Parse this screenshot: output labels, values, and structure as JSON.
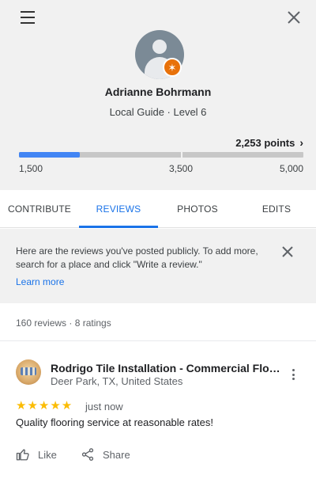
{
  "header": {
    "menu_icon": "hamburger-menu-icon",
    "close_icon": "close-icon"
  },
  "profile": {
    "name": "Adrianne Bohrmann",
    "level_text": "Local Guide · Level 6",
    "badge_icon": "local-guide-star-icon",
    "badge_color": "#e8710a"
  },
  "progress": {
    "points_label": "2,253 points",
    "chevron": "›",
    "min_label": "1,500",
    "mid_label": "3,500",
    "max_label": "5,000",
    "min": 1500,
    "max": 5000,
    "value": 2253,
    "fill_color": "#4285f4"
  },
  "tabs": [
    {
      "label": "CONTRIBUTE",
      "active": false
    },
    {
      "label": "REVIEWS",
      "active": true
    },
    {
      "label": "PHOTOS",
      "active": false
    },
    {
      "label": "EDITS",
      "active": false
    }
  ],
  "info_banner": {
    "text": "Here are the reviews you've posted publicly. To add more, search for a place and click \"Write a review.\"",
    "link": "Learn more"
  },
  "counts": "160 reviews · 8 ratings",
  "review_card": {
    "business_name": "Rodrigo Tile Installation - Commercial Floor...",
    "address": "Deer Park, TX, United States",
    "rating": 5,
    "stars": "★★★★★",
    "time": "just now",
    "text": "Quality flooring service at reasonable rates!",
    "like_label": "Like",
    "share_label": "Share",
    "star_color": "#fbbc04"
  },
  "accent_color": "#1a73e8"
}
